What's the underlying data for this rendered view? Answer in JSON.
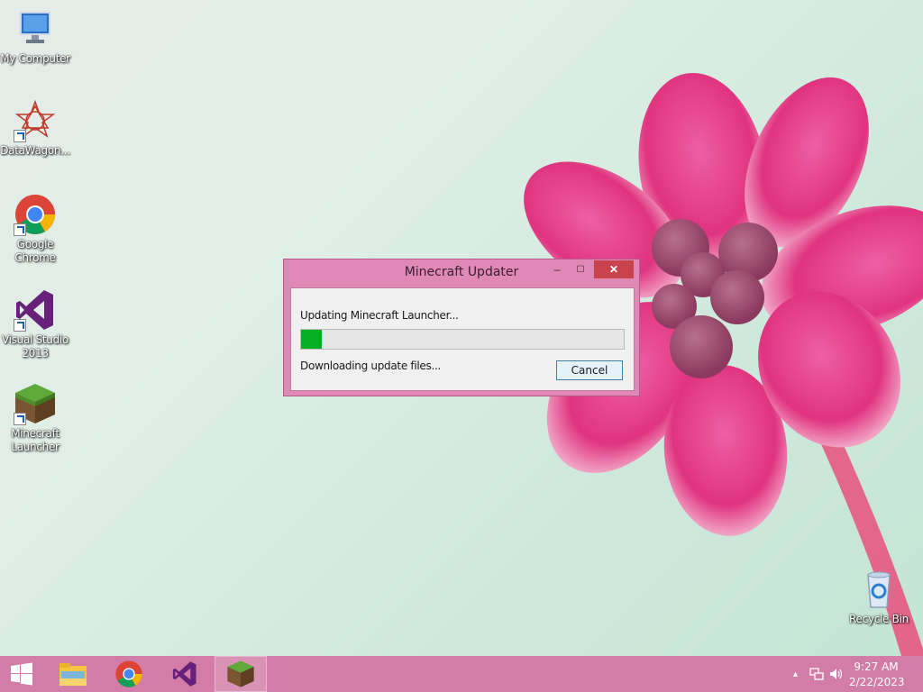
{
  "desktop": {
    "icons": [
      {
        "label": "My Computer"
      },
      {
        "label": "DataWagon..."
      },
      {
        "label": "Google Chrome"
      },
      {
        "label": "Visual Studio 2013"
      },
      {
        "label": "Minecraft Launcher"
      },
      {
        "label": "Recycle Bin"
      }
    ]
  },
  "dialog": {
    "title": "Minecraft Updater",
    "status_top": "Updating Minecraft Launcher...",
    "status_bottom": "Downloading update files...",
    "progress_fraction": 0.065,
    "cancel_label": "Cancel",
    "close_symbol": "✕",
    "min_symbol": "‒",
    "max_symbol": "☐"
  },
  "taskbar": {
    "items": [
      "start-button",
      "file-explorer",
      "google-chrome",
      "visual-studio",
      "minecraft-launcher"
    ],
    "time": "9:27 AM",
    "date": "2/22/2023"
  },
  "colors": {
    "title_bar": "#e088b6",
    "taskbar": "#d27ca8",
    "progress_green": "#06b025",
    "close_red": "#c9434c"
  }
}
